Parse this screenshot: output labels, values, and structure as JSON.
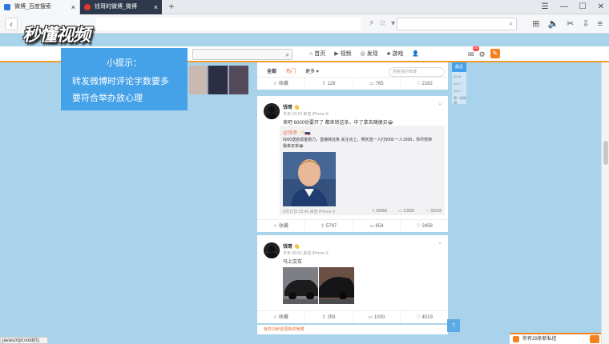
{
  "browser": {
    "tabs": [
      {
        "title": "微博_百度搜索",
        "active": false
      },
      {
        "title": "钱哥的微博_微博",
        "active": true
      }
    ],
    "new_tab": "+",
    "window_controls": [
      "☰",
      "—",
      "☐",
      "✕"
    ],
    "back": "‹"
  },
  "watermark": {
    "text": "秒懂视频"
  },
  "weibo_nav": {
    "search_icon": "search-icon",
    "links": [
      {
        "icon": "⌂",
        "label": "首页"
      },
      {
        "icon": "▶",
        "label": "视频"
      },
      {
        "icon": "◎",
        "label": "发现"
      },
      {
        "icon": "♣",
        "label": "游戏"
      },
      {
        "icon": "👤",
        "label": ""
      }
    ],
    "message_badge": "20"
  },
  "hint": {
    "title": "小提示：",
    "line1": "转发微博时评论字数要多",
    "line2": "要符合举办放心理"
  },
  "feed_tabs": {
    "items": [
      {
        "label": "全部",
        "state": "active"
      },
      {
        "label": "热门",
        "state": "hot"
      },
      {
        "label": "更多 ▾",
        "state": "normal"
      }
    ],
    "search_placeholder": "搜索我的微博",
    "stats": [
      "☆ 收藏",
      "⇪ 128",
      "▭ 765",
      "♡ 2182"
    ]
  },
  "post1": {
    "name": "钱哥 👋",
    "meta": "今天 10:16 来自 iPhone X",
    "text": "来吧 6000份要开了 都来转这条，中了拿去随便买😂",
    "repost_name": "@钱哥 🥂🇷🇺",
    "repost_text": "6000送给现金助力，直接转这条 关注点上，明天选一人打5000 一人1000，你尽管转 我来买单😂",
    "repost_meta": "6月17日 22:46 来自 iPhone X",
    "repost_stats": [
      "⇪ 58066",
      "▭ 13626",
      "♡ 35228"
    ],
    "stats": [
      "☆ 收藏",
      "⇪ 5797",
      "▭ 654",
      "♡ 2458"
    ]
  },
  "post2": {
    "name": "钱哥 👋",
    "meta": "今天 09:51 来自 iPhone X",
    "text": "马上交车",
    "stats": [
      "☆ 收藏",
      "⇪ 259",
      "▭ 1000",
      "♡ 4019"
    ]
  },
  "footer_note": "有你10秒前更新的微博",
  "side": {
    "title": "最近",
    "items": [
      "2018",
      "2017",
      "2017",
      "第一条微博"
    ]
  },
  "chat": {
    "text": "你有29条新私信"
  },
  "status": "javascript:void(0);",
  "colors": {
    "accent": "#f39c2b",
    "page_bg": "#a9d3ea",
    "hint_bg": "#45a1e8"
  }
}
